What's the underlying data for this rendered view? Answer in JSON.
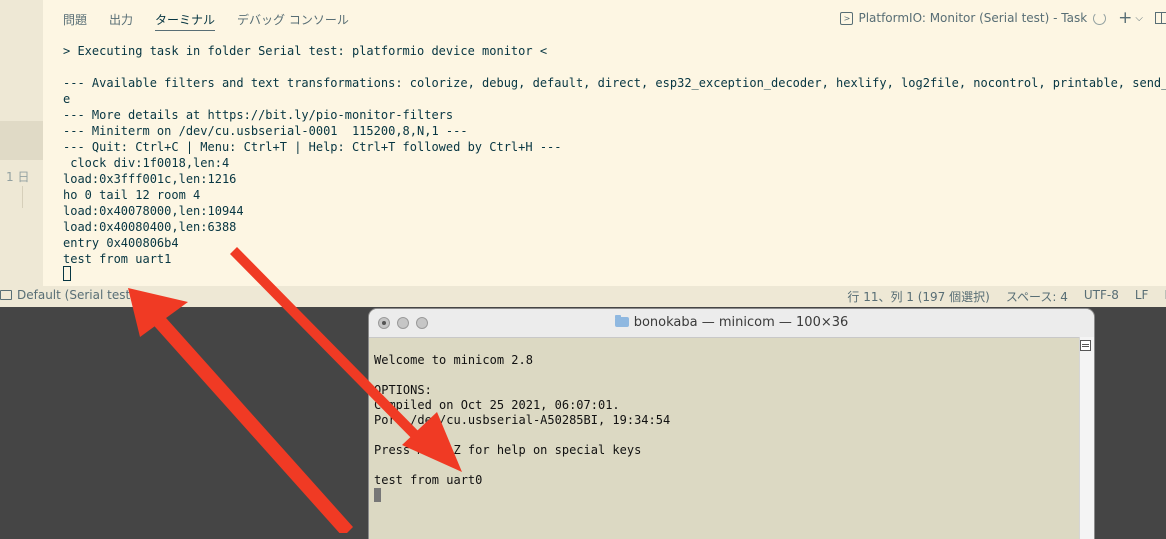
{
  "vscode": {
    "gutter_text": "1 日",
    "panel_tabs": [
      "問題",
      "出力",
      "ターミナル",
      "デバッグ コンソール"
    ],
    "active_tab_index": 2,
    "task_label": "PlatformIO: Monitor (Serial test) - Task",
    "task_icon": "terminal-icon",
    "terminal_lines": [
      "> Executing task in folder Serial test: platformio device monitor <",
      "",
      "--- Available filters and text transformations: colorize, debug, default, direct, esp32_exception_decoder, hexlify, log2file, nocontrol, printable, send_on_ent",
      "e",
      "--- More details at https://bit.ly/pio-monitor-filters",
      "--- Miniterm on /dev/cu.usbserial-0001  115200,8,N,1 ---",
      "--- Quit: Ctrl+C | Menu: Ctrl+T | Help: Ctrl+T followed by Ctrl+H ---",
      " clock div:1f0018,len:4",
      "load:0x3fff001c,len:1216",
      "ho 0 tail 12 room 4",
      "load:0x40078000,len:10944",
      "load:0x40080400,len:6388",
      "entry 0x400806b4",
      "test from uart1"
    ],
    "status_left": "Default (Serial test)",
    "status_right": [
      "行 11、列 1 (197 個選択)",
      "スペース: 4",
      "UTF-8",
      "LF",
      "I"
    ]
  },
  "minicom": {
    "title": "bonokaba — minicom — 100×36",
    "lines": [
      "Welcome to minicom 2.8",
      "",
      "OPTIONS:",
      "Compiled on Oct 25 2021, 06:07:01.",
      "Port /dev/cu.usbserial-A50285BI, 19:34:54",
      "",
      "Press Meta-Z for help on special keys",
      "",
      "test from uart0"
    ]
  },
  "colors": {
    "vscode_background": "#fdf6e3",
    "statusbar": "#eee8d5",
    "minicom_background": "#dcd9c3",
    "arrow": "#f03a24"
  }
}
